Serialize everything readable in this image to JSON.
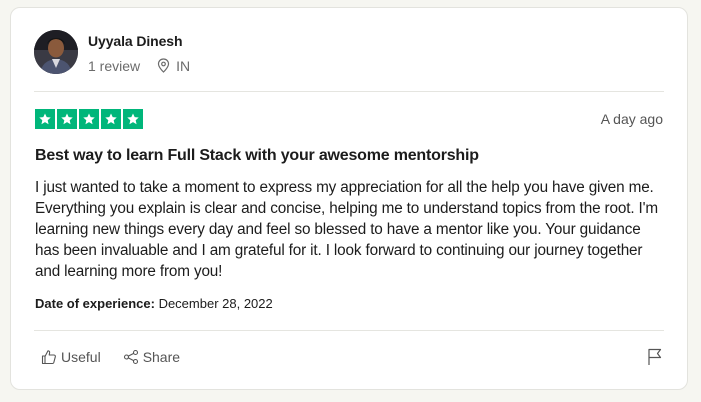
{
  "reviewer": {
    "name": "Uyyala Dinesh",
    "reviews": "1 review",
    "country": "IN"
  },
  "review": {
    "rating": 5,
    "date": "A day ago",
    "title": "Best way to learn Full Stack with your awesome mentorship",
    "body": "I just wanted to take a moment to express my appreciation for all the help you have given me. Everything you explain is clear and concise, helping me to understand topics from the root. I'm learning new things every day and feel so blessed to have a mentor like you. Your guidance has been invaluable and I am grateful for it. I look forward to continuing our journey together and learning more from you!",
    "experience_label": "Date of experience:",
    "experience_date": "December 28, 2022"
  },
  "actions": {
    "useful": "Useful",
    "share": "Share"
  },
  "icons": {
    "star": "star-icon",
    "location": "location-pin-icon",
    "useful": "thumbs-up-icon",
    "share": "share-icon",
    "flag": "flag-icon"
  },
  "colors": {
    "star_bg": "#00b67a",
    "text": "#1c1c1c",
    "muted": "#6b6b6b"
  }
}
